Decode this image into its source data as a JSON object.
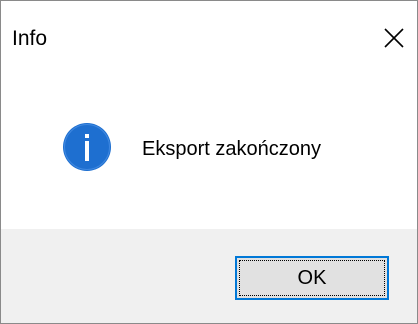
{
  "window": {
    "title": "Info",
    "close_icon": "close-icon"
  },
  "message": {
    "icon": "info-icon",
    "text": "Eksport zakończony"
  },
  "buttons": {
    "ok_label": "OK"
  },
  "colors": {
    "info_icon": "#1e6fd0",
    "footer_background": "#f0f0f0",
    "button_border": "#0078d7",
    "button_background": "#e1e1e1"
  }
}
